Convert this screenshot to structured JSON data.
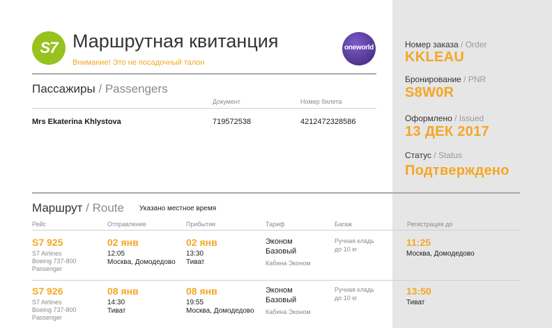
{
  "header": {
    "logo_text": "S7",
    "title": "Маршрутная квитанция",
    "warning": "Внимание! Это не посадочный талон",
    "alliance_logo": "oneworld"
  },
  "passengers": {
    "title_ru": "Пассажиры",
    "title_en": "Passengers",
    "separator": " / ",
    "col_document": "Документ",
    "col_ticket": "Номер билета",
    "rows": [
      {
        "name": "Mrs Ekaterina Khlystova",
        "document": "719572538",
        "ticket": "4212472328586"
      }
    ]
  },
  "sidebar": {
    "order_label_ru": "Номер заказа",
    "order_label_en": "Order",
    "order_value": "KKLEAU",
    "pnr_label_ru": "Бронирование",
    "pnr_label_en": "PNR",
    "pnr_value": "S8W0R",
    "issued_label_ru": "Оформлено",
    "issued_label_en": "Issued",
    "issued_value": "13 ДЕК 2017",
    "status_label_ru": "Статус",
    "status_label_en": "Status",
    "status_value": "Подтверждено"
  },
  "route": {
    "title_ru": "Маршрут",
    "title_en": "Route",
    "note": "Указано местное время",
    "columns": {
      "flight": "Рейс",
      "departure": "Отправление",
      "arrival": "Прибытие",
      "fare": "Тариф",
      "baggage": "Багаж",
      "checkin": "Регистрация до"
    },
    "flights": [
      {
        "number": "S7 925",
        "airline": "S7 Airlines",
        "aircraft": "Boeing 737-800",
        "pax": "Passenger",
        "dep_date": "02 янв",
        "dep_time": "12:05",
        "dep_place": "Москва, Домодедово",
        "arr_date": "02 янв",
        "arr_time": "13:30",
        "arr_place": "Тиват",
        "fare_1": "Эконом",
        "fare_2": "Базовый",
        "cabin": "Кабина Эконом",
        "baggage_1": "Ручная кладь",
        "baggage_2": "до 10 кг",
        "checkin_time": "11:25",
        "checkin_place": "Москва, Домодедово"
      },
      {
        "number": "S7 926",
        "airline": "S7 Airlines",
        "aircraft": "Boeing 737-800",
        "pax": "Passenger",
        "dep_date": "08 янв",
        "dep_time": "14:30",
        "dep_place": "Тиват",
        "arr_date": "08 янв",
        "arr_time": "19:55",
        "arr_place": "Москва, Домодедово",
        "fare_1": "Эконом",
        "fare_2": "Базовый",
        "cabin": "Кабина Эконом",
        "baggage_1": "Ручная кладь",
        "baggage_2": "до 10 кг",
        "checkin_time": "13:50",
        "checkin_place": "Тиват"
      }
    ]
  }
}
